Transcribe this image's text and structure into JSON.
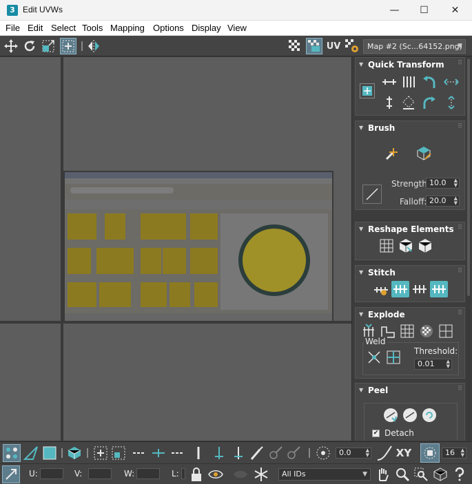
{
  "window": {
    "app_icon_glyph": "3",
    "title": "Edit UVWs",
    "minimize": "—",
    "maximize": "☐",
    "close": "✕"
  },
  "menu": [
    "File",
    "Edit",
    "Select",
    "Tools",
    "Mapping",
    "Options",
    "Display",
    "View"
  ],
  "toolbar": {
    "uv_label": "UV",
    "map_dropdown": "Map #2 (Sc...64152.png)"
  },
  "panel": {
    "quick_transform": {
      "title": "Quick Transform"
    },
    "brush": {
      "title": "Brush",
      "strength_label": "Strength:",
      "strength_value": "10.0",
      "falloff_label": "Falloff:",
      "falloff_value": "20.0"
    },
    "reshape": {
      "title": "Reshape Elements"
    },
    "stitch": {
      "title": "Stitch"
    },
    "explode": {
      "title": "Explode",
      "weld_label": "Weld",
      "threshold_label": "Threshold:",
      "threshold_value": "0.01"
    },
    "peel": {
      "title": "Peel",
      "detach_label": "Detach",
      "detach_checked": true
    }
  },
  "status": {
    "rotate_value": "0.0",
    "xy_label": "XY",
    "pixel_snap_value": "16",
    "u_label": "U:",
    "v_label": "V:",
    "w_label": "W:",
    "l_label": "L:",
    "ids_dropdown": "All IDs"
  },
  "colors": {
    "accent_teal": "#55b8c0",
    "viewport_bg": "#5d5d5d",
    "panel_bg": "#3c3c3c"
  }
}
